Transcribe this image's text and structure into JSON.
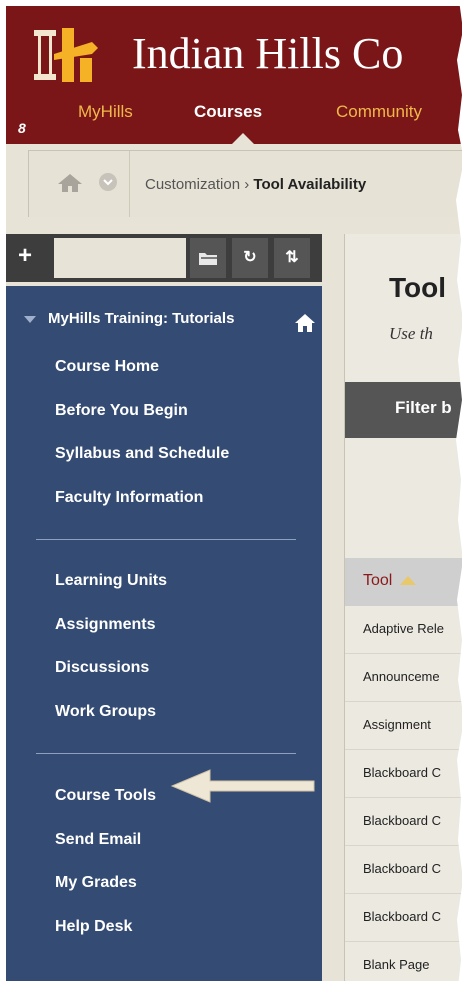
{
  "header": {
    "college_name": "Indian Hills Co",
    "nav": [
      {
        "label": "MyHills"
      },
      {
        "label": "Courses"
      },
      {
        "label": "Community"
      }
    ],
    "colors": {
      "banner": "#7a1618",
      "nav_link": "#f0b84a",
      "logo_gold": "#f5b226"
    }
  },
  "breadcrumb": {
    "parent": "Customization",
    "separator": "›",
    "current": "Tool Availability"
  },
  "sidebar": {
    "toolbar_icons": [
      "plus-icon",
      "folder-icon",
      "refresh-icon",
      "sort-icon"
    ],
    "course_title": "MyHills Training: Tutorials",
    "groups": [
      {
        "items": [
          {
            "label": "Course Home"
          },
          {
            "label": "Before You Begin"
          },
          {
            "label": "Syllabus and Schedule"
          },
          {
            "label": "Faculty Information"
          }
        ]
      },
      {
        "items": [
          {
            "label": "Learning Units"
          },
          {
            "label": "Assignments"
          },
          {
            "label": "Discussions"
          },
          {
            "label": "Work Groups"
          }
        ]
      },
      {
        "items": [
          {
            "label": "Course Tools"
          },
          {
            "label": "Send Email"
          },
          {
            "label": "My Grades"
          },
          {
            "label": "Help Desk"
          }
        ]
      }
    ],
    "colors": {
      "background": "#344b73"
    }
  },
  "main": {
    "title": "Tool",
    "description": "Use th",
    "filter_label": "Filter b",
    "table": {
      "header": "Tool",
      "rows": [
        "Adaptive Rele",
        "Announceme",
        "Assignment",
        "Blackboard C",
        "Blackboard C",
        "Blackboard C",
        "Blackboard C",
        "Blank Page"
      ]
    }
  }
}
